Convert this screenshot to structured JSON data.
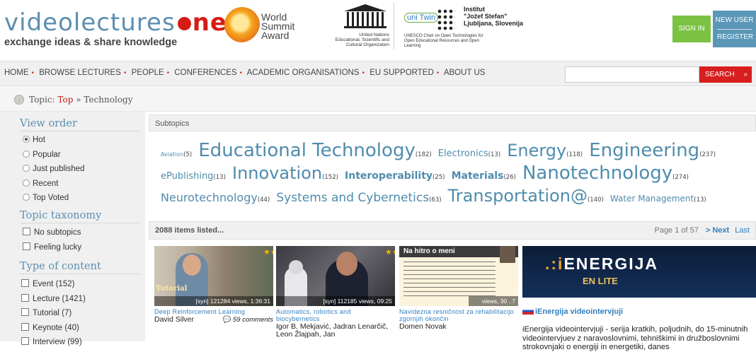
{
  "brand": {
    "name_left": "videolecture",
    "name_s": "s",
    "name_right": "net",
    "tagline": "exchange ideas & share knowledge"
  },
  "partners": {
    "wsa": [
      "World",
      "Summit",
      "Award"
    ],
    "unesco_text": "United Nations Educational, Scientific and Cultural Organization",
    "unitwin": "uni Twin",
    "ijs": [
      "Institut",
      "\"Jožef Stefan\"",
      "Ljubljana, Slovenija"
    ],
    "chair": "UNESCO Chair on Open Technologies for Open Educational Resources and Open Learning"
  },
  "auth": {
    "signin": "SIGN IN",
    "newuser": "NEW USER",
    "register": "REGISTER"
  },
  "nav": [
    "HOME",
    "BROWSE LECTURES",
    "PEOPLE",
    "CONFERENCES",
    "ACADEMIC ORGANISATIONS",
    "EU SUPPORTED",
    "ABOUT US"
  ],
  "search": {
    "placeholder": "",
    "button": "SEARCH",
    "arrows": "»"
  },
  "breadcrumb": {
    "prefix": "Topic:",
    "top": "Top",
    "sep": "»",
    "current": "Technology"
  },
  "sidebar": {
    "view_order": {
      "title": "View order",
      "options": [
        "Hot",
        "Popular",
        "Just published",
        "Recent",
        "Top Voted"
      ],
      "selected": "Hot"
    },
    "taxonomy": {
      "title": "Topic taxonomy",
      "options": [
        "No subtopics",
        "Feeling lucky"
      ]
    },
    "content": {
      "title": "Type of content",
      "options": [
        "Event (152)",
        "Lecture (1421)",
        "Tutorial (7)",
        "Keynote (40)",
        "Interview (99)"
      ]
    }
  },
  "subtopics": {
    "title": "Subtopics",
    "items": [
      {
        "name": "Aviation",
        "count": "(5)",
        "size": 8
      },
      {
        "name": "Educational Technology",
        "count": "(182)",
        "size": 26
      },
      {
        "name": "Electronics",
        "count": "(13)",
        "size": 13
      },
      {
        "name": "Energy",
        "count": "(118)",
        "size": 24
      },
      {
        "name": "Engineering",
        "count": "(237)",
        "size": 26
      },
      {
        "name": "ePublishing",
        "count": "(13)",
        "size": 13
      },
      {
        "name": "Innovation",
        "count": "(152)",
        "size": 24
      },
      {
        "name": "Interoperability",
        "count": "(25)",
        "size": 14,
        "bold": true
      },
      {
        "name": "Materials",
        "count": "(26)",
        "size": 14,
        "bold": true
      },
      {
        "name": "Nanotechnology",
        "count": "(274)",
        "size": 26
      },
      {
        "name": "Neurotechnology",
        "count": "(44)",
        "size": 16
      },
      {
        "name": "Systems and Cybernetics",
        "count": "(63)",
        "size": 17
      },
      {
        "name": "Transportation@",
        "count": "(140)",
        "size": 24
      },
      {
        "name": "Water Management",
        "count": "(13)",
        "size": 12
      }
    ]
  },
  "listing": {
    "count": "2088 items listed...",
    "page": "Page 1 of 57",
    "next": "> Next",
    "last": "Last"
  },
  "videos": [
    {
      "title": "Deep Reinforcement Learning",
      "author": "David Silver",
      "meta": "[syn]  121284 views, 1:36:31",
      "comments": "59 comments",
      "label": "Tutorial"
    },
    {
      "title": "Automatics, robotics and biocybernetics",
      "author": "Igor B. Mekjavić, Jadran Lenarčič, Leon Žlajpah, Jan",
      "meta": "[syn]  112185 views, 09:25"
    },
    {
      "title": "Navidezna resničnost za rehabilitacijo zgornjih okončin",
      "author": "Domen Novak",
      "meta": "views, 30 ..7",
      "slide_title": "Na hitro o meni"
    }
  ],
  "promo": {
    "banner": {
      "prefix": ".:i",
      "word": "ENERGIJA",
      "sub": "EN LITE"
    },
    "title": "iEnergija videointervjuji",
    "desc": "iEnergija videointervjuji - serija kratkih, poljudnih, do 15-minutnih videointervjuev z naravoslovnimi, tehniškimi in družboslovnimi strokovnjaki o energiji in energetiki, danes"
  },
  "colors": {
    "brand_blue": "#5b8fb0",
    "brand_red": "#d51d14",
    "link": "#2f7fc0",
    "signin": "#7bc243",
    "register": "#5a97b8",
    "search": "#d81e1e"
  }
}
